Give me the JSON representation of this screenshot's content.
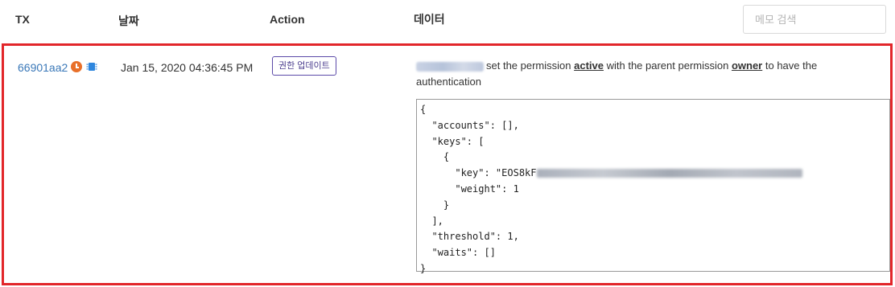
{
  "header": {
    "tx": "TX",
    "date": "날짜",
    "action": "Action",
    "data": "데이터",
    "memo_placeholder": "메모 검색"
  },
  "row": {
    "tx_id": "66901aa2",
    "date": "Jan 15, 2020 04:36:45 PM",
    "action_badge": "권한 업데이트",
    "desc_pre": "set the permission ",
    "permission": "active",
    "desc_mid": " with the parent permission ",
    "parent": "owner",
    "desc_post": " to have the authentication",
    "json_lines": [
      "{",
      "  \"accounts\": [],",
      "  \"keys\": [",
      "    {",
      "      \"key\": \"EOS8kF",
      "      \"weight\": 1",
      "    }",
      "  ],",
      "  \"threshold\": 1,",
      "  \"waits\": []",
      "}"
    ]
  },
  "colors": {
    "highlight_border": "#e2262a",
    "link": "#3a78b8",
    "badge": "#5b4aa8",
    "clock": "#e8702a",
    "chip": "#2e86de"
  },
  "icons": [
    "clock-icon",
    "chip-icon"
  ]
}
